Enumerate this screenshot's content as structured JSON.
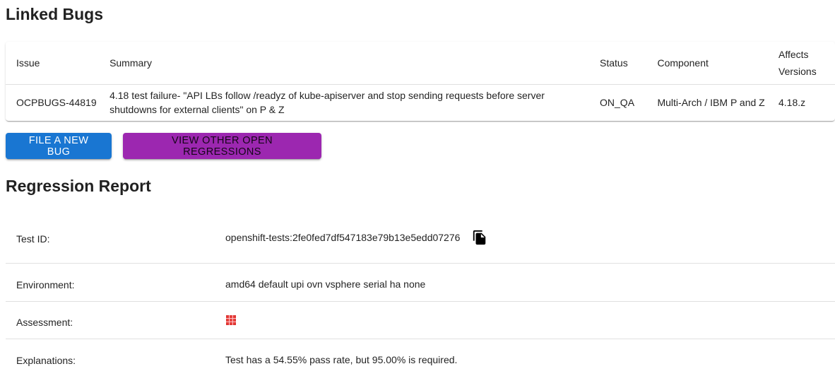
{
  "linked_bugs": {
    "title": "Linked Bugs",
    "columns": [
      "Issue",
      "Summary",
      "Status",
      "Component",
      "Affects Versions"
    ],
    "rows": [
      {
        "issue": "OCPBUGS-44819",
        "summary": "4.18 test failure- \"API LBs follow /readyz of kube-apiserver and stop sending requests before server shutdowns for external clients\" on P & Z",
        "status": "ON_QA",
        "component": "Multi-Arch / IBM P and Z",
        "affects_versions": "4.18.z"
      }
    ]
  },
  "buttons": {
    "file_bug": "FILE A NEW BUG",
    "view_regressions": "VIEW OTHER OPEN REGRESSIONS"
  },
  "regression_report": {
    "title": "Regression Report",
    "test_id_label": "Test ID:",
    "test_id_value": "openshift-tests:2fe0fed7df547183e79b13e5edd07276",
    "environment_label": "Environment:",
    "environment_value": "amd64 default upi ovn vsphere serial ha none",
    "assessment_label": "Assessment:",
    "assessment_icon": "red-grid-icon",
    "explanations_label": "Explanations:",
    "explanations_value": "Test has a 54.55% pass rate, but 95.00% is required."
  },
  "colors": {
    "primary": "#1976d2",
    "secondary": "#9c27b0",
    "assessment_red": "#e53935"
  }
}
